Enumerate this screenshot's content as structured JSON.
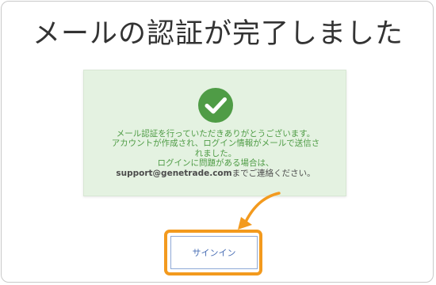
{
  "page": {
    "title": "メールの認証が完了しました"
  },
  "card": {
    "icon": "check-circle-icon",
    "lines": [
      "メール認証を行っていただきありがとうございます。",
      "アカウントが作成され、ログイン情報がメールで送信さ",
      "れました。",
      "ログインに問題がある場合は、"
    ],
    "support_email": "support@genetrade.com",
    "support_tail": "までご連絡ください。"
  },
  "signin_button": {
    "label": "サインイン"
  },
  "colors": {
    "success_green": "#4f9c46",
    "card_background": "#e4f2e1",
    "highlight_orange": "#f39a1e",
    "button_text": "#4a6fb5"
  }
}
